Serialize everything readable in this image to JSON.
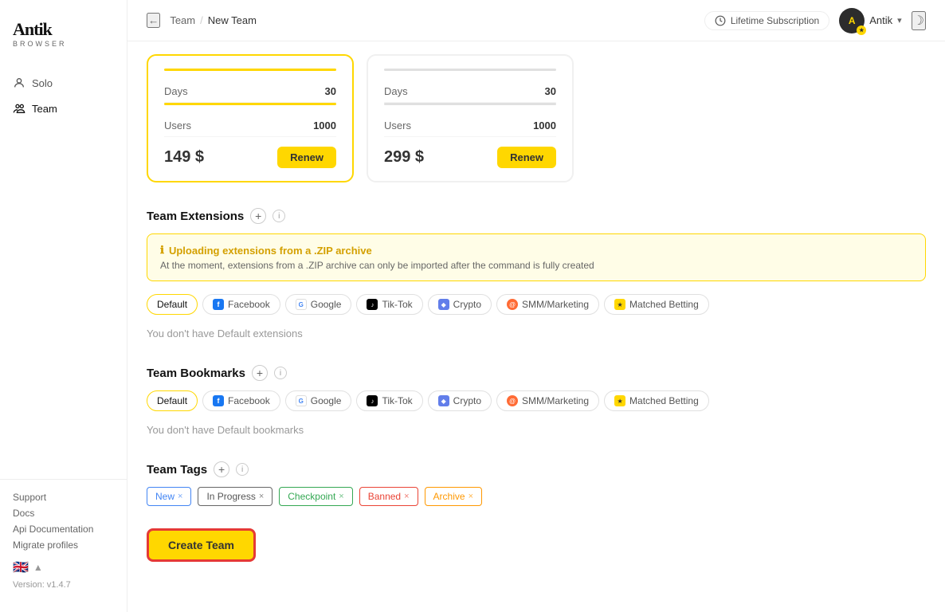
{
  "app": {
    "logo": "Antik",
    "logo_sub": "BROWSER"
  },
  "sidebar": {
    "nav_items": [
      {
        "id": "solo",
        "label": "Solo",
        "icon": "person"
      },
      {
        "id": "team",
        "label": "Team",
        "icon": "group",
        "active": true
      }
    ],
    "links": [
      "Support",
      "Docs",
      "Api Documentation",
      "Migrate profiles"
    ],
    "version": "Version: v1.4.7"
  },
  "header": {
    "back_label": "←",
    "breadcrumb_parent": "Team",
    "breadcrumb_sep": "/",
    "breadcrumb_current": "New Team",
    "subscription_label": "Lifetime Subscription",
    "user_name": "Antik"
  },
  "plans": [
    {
      "id": "plan1",
      "active": true,
      "days_label": "Days",
      "days_value": "30",
      "users_label": "Users",
      "users_value": "1000",
      "price": "149 $",
      "renew_label": "Renew"
    },
    {
      "id": "plan2",
      "active": false,
      "days_label": "Days",
      "days_value": "30",
      "users_label": "Users",
      "users_value": "1000",
      "price": "299 $",
      "renew_label": "Renew"
    }
  ],
  "extensions": {
    "section_title": "Team Extensions",
    "warning_title": "Uploading extensions from a .ZIP archive",
    "warning_text": "At the moment, extensions from a .ZIP archive can only be imported after the command is fully created",
    "tabs": [
      "Default",
      "Facebook",
      "Google",
      "Tik-Tok",
      "Crypto",
      "SMM/Marketing",
      "Matched Betting"
    ],
    "active_tab": "Default",
    "empty_text": "You don't have Default extensions"
  },
  "bookmarks": {
    "section_title": "Team Bookmarks",
    "tabs": [
      "Default",
      "Facebook",
      "Google",
      "Tik-Tok",
      "Crypto",
      "SMM/Marketing",
      "Matched Betting"
    ],
    "active_tab": "Default",
    "empty_text": "You don't have Default bookmarks"
  },
  "tags": {
    "section_title": "Team Tags",
    "items": [
      {
        "label": "New",
        "type": "blue"
      },
      {
        "label": "In Progress",
        "type": "default"
      },
      {
        "label": "Checkpoint",
        "type": "green"
      },
      {
        "label": "Banned",
        "type": "red"
      },
      {
        "label": "Archive",
        "type": "orange"
      }
    ]
  },
  "create_button": {
    "label": "Create Team"
  }
}
